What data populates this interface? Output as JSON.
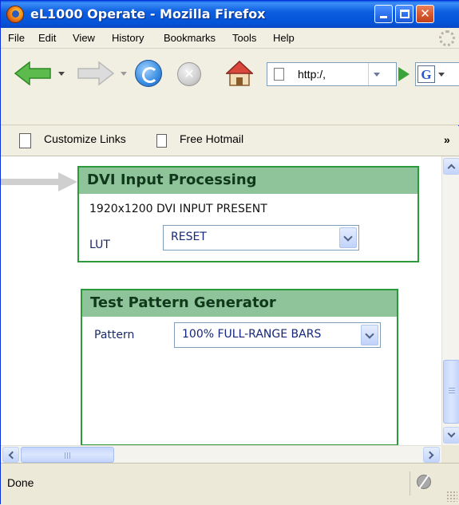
{
  "window": {
    "title": "eL1000 Operate - Mozilla Firefox"
  },
  "menubar": {
    "items": [
      "File",
      "Edit",
      "View",
      "History",
      "Bookmarks",
      "Tools",
      "Help"
    ]
  },
  "navbar": {
    "url": "http:/,",
    "search_engine_letter": "G"
  },
  "bookmarks": {
    "items": [
      "Customize Links",
      "Free Hotmail"
    ],
    "overflow": "»"
  },
  "dvi_panel": {
    "title": "DVI Input Processing",
    "status": "1920x1200 DVI INPUT PRESENT",
    "lut_label": "LUT",
    "lut_value": "RESET"
  },
  "test_pattern_panel": {
    "title": "Test Pattern Generator",
    "pattern_label": "Pattern",
    "pattern_value": "100% FULL-RANGE BARS"
  },
  "statusbar": {
    "text": "Done"
  },
  "colors": {
    "titlebar": "#0452d6",
    "panel_border": "#2b9a3b",
    "panel_header": "#8fc49a",
    "select_text": "#16277a"
  }
}
